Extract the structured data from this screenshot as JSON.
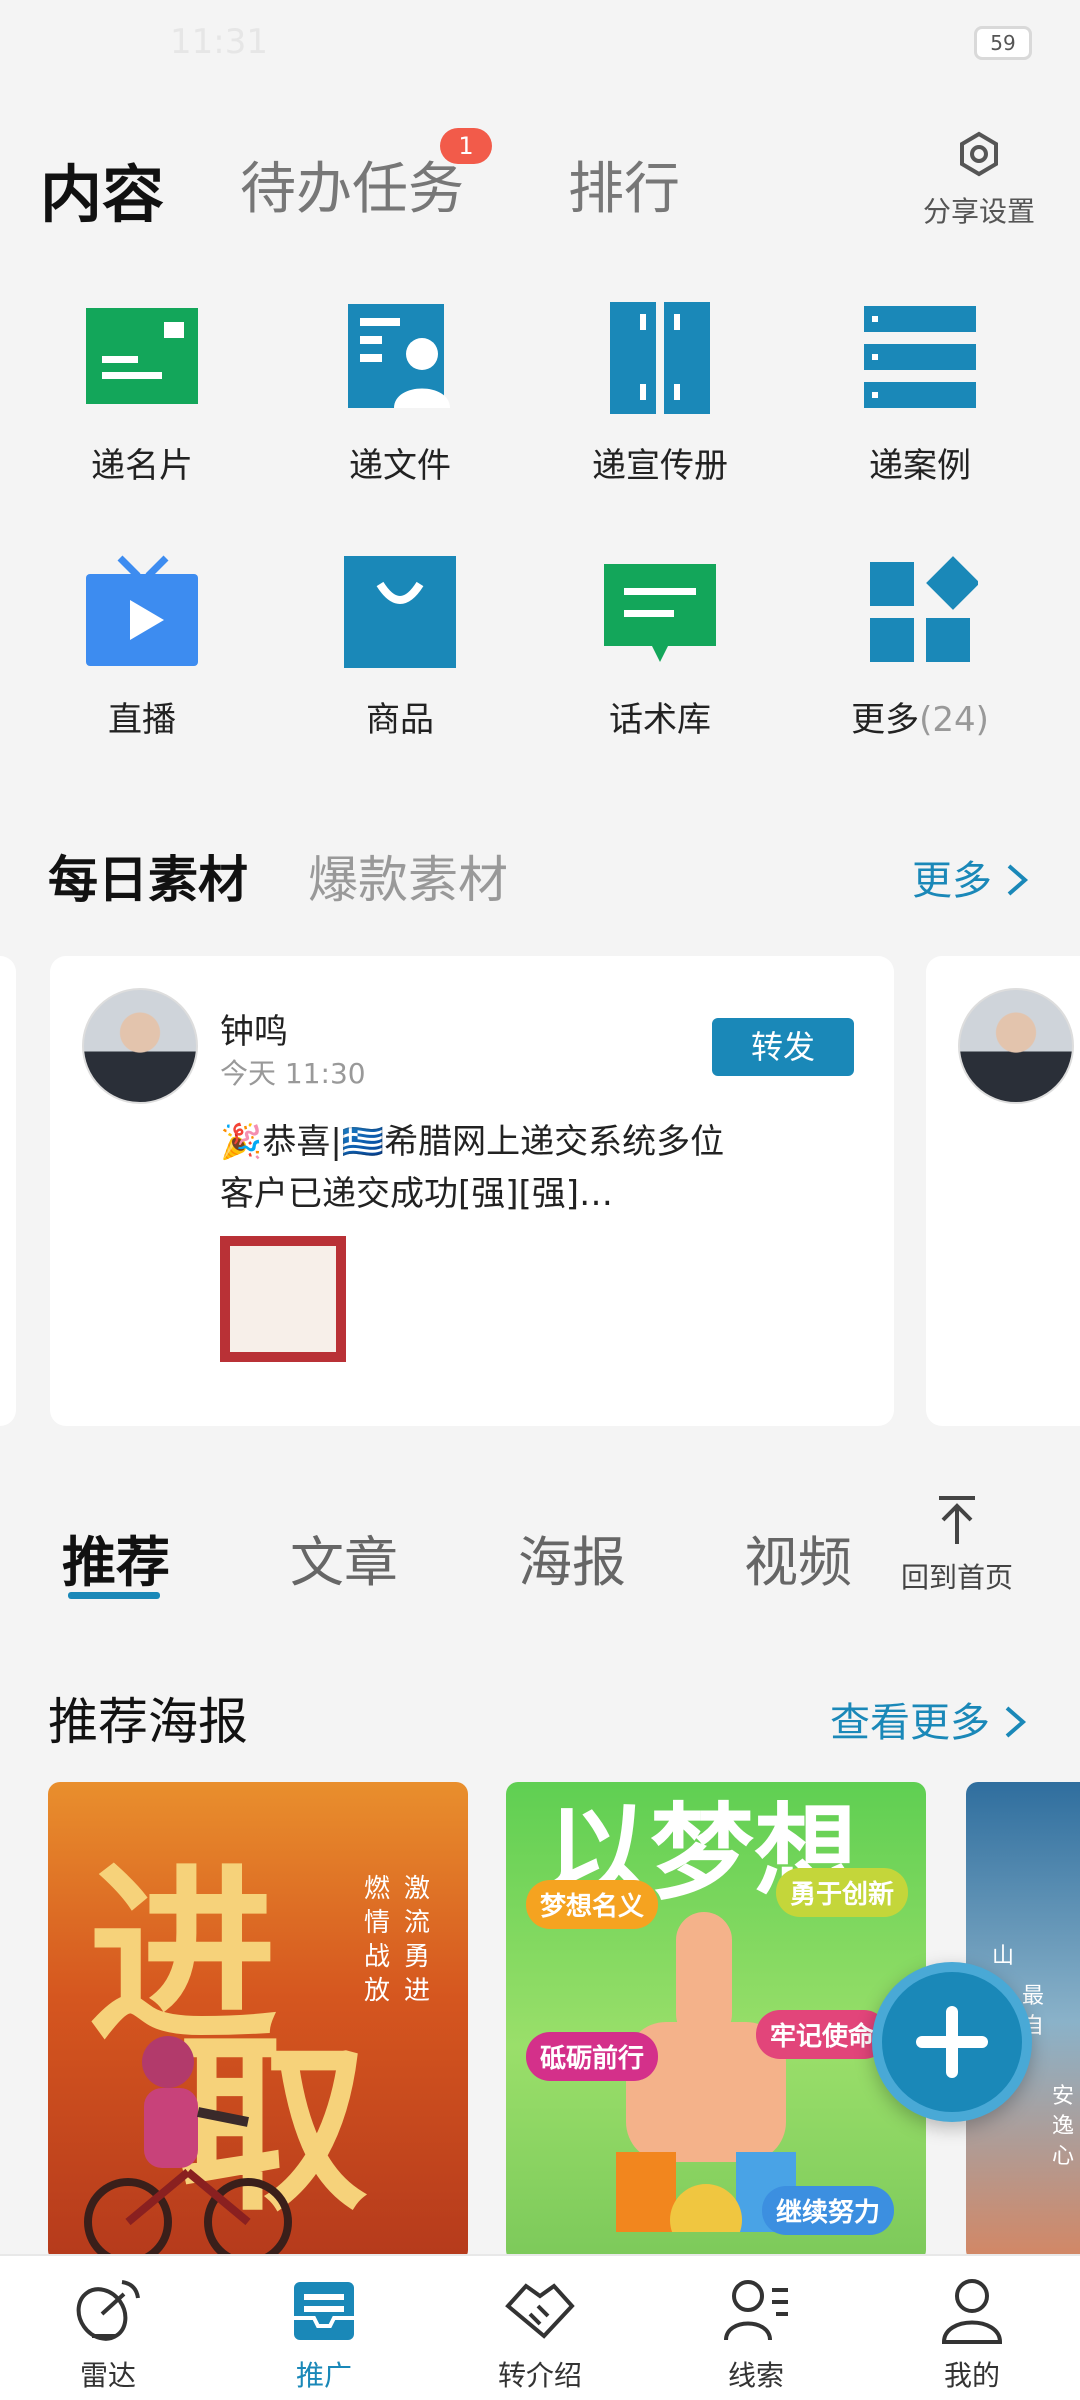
{
  "status_bar": {
    "time": "11:31",
    "battery": "59"
  },
  "top_tabs": [
    {
      "label": "内容",
      "active": true
    },
    {
      "label": "待办任务",
      "badge": "1"
    },
    {
      "label": "排行"
    }
  ],
  "share_settings": {
    "label": "分享设置",
    "icon": "hexagon-settings-icon"
  },
  "quick_grid": [
    {
      "label": "递名片",
      "icon": "business-card-icon",
      "color": "#13a65a"
    },
    {
      "label": "递文件",
      "icon": "file-user-icon",
      "color": "#1a88b8"
    },
    {
      "label": "递宣传册",
      "icon": "brochure-icon",
      "color": "#1a88b8"
    },
    {
      "label": "递案例",
      "icon": "case-list-icon",
      "color": "#1a88b8"
    },
    {
      "label": "直播",
      "icon": "tv-live-icon",
      "color": "#3d8cf0"
    },
    {
      "label": "商品",
      "icon": "shopping-bag-icon",
      "color": "#1a88b8"
    },
    {
      "label": "话术库",
      "icon": "chat-bubble-icon",
      "color": "#13a65a"
    },
    {
      "label": "更多",
      "count": "(24)",
      "icon": "apps-grid-icon",
      "color": "#1a88b8"
    }
  ],
  "material": {
    "tabs": [
      {
        "label": "每日素材",
        "active": true
      },
      {
        "label": "爆款素材"
      }
    ],
    "more": "更多",
    "card": {
      "name": "钟鸣",
      "time": "今天 11:30",
      "forward": "转发",
      "text_line1": "🎉恭喜|🇬🇷希腊网上递交系统多位",
      "text_line2": "客户已递交成功[强][强]…"
    }
  },
  "content_tabs": [
    {
      "label": "推荐",
      "active": true
    },
    {
      "label": "文章"
    },
    {
      "label": "海报"
    },
    {
      "label": "视频"
    }
  ],
  "back_home": "回到首页",
  "posters": {
    "title": "推荐海报",
    "more": "查看更多",
    "poster1": {
      "big1": "进",
      "big2": "取",
      "col1": "激流勇进",
      "col2": "燃情战放"
    },
    "poster2": {
      "headline": "以梦想",
      "tag1": "梦想名义",
      "tag2": "勇于创新",
      "tag3": "砥砺前行",
      "tag4": "牢记使命",
      "tag5": "继续努力"
    },
    "poster3": {
      "col1": "山",
      "col2": "最自",
      "col3": "安逸心"
    }
  },
  "bottom_nav": [
    {
      "label": "雷达",
      "icon": "radar-dish-icon"
    },
    {
      "label": "推广",
      "icon": "promote-inbox-icon",
      "active": true
    },
    {
      "label": "转介绍",
      "icon": "handshake-icon"
    },
    {
      "label": "线索",
      "icon": "leads-person-icon"
    },
    {
      "label": "我的",
      "icon": "profile-icon"
    }
  ],
  "colors": {
    "accent": "#1a88b8",
    "green": "#13a65a",
    "badge": "#f25b4a"
  }
}
